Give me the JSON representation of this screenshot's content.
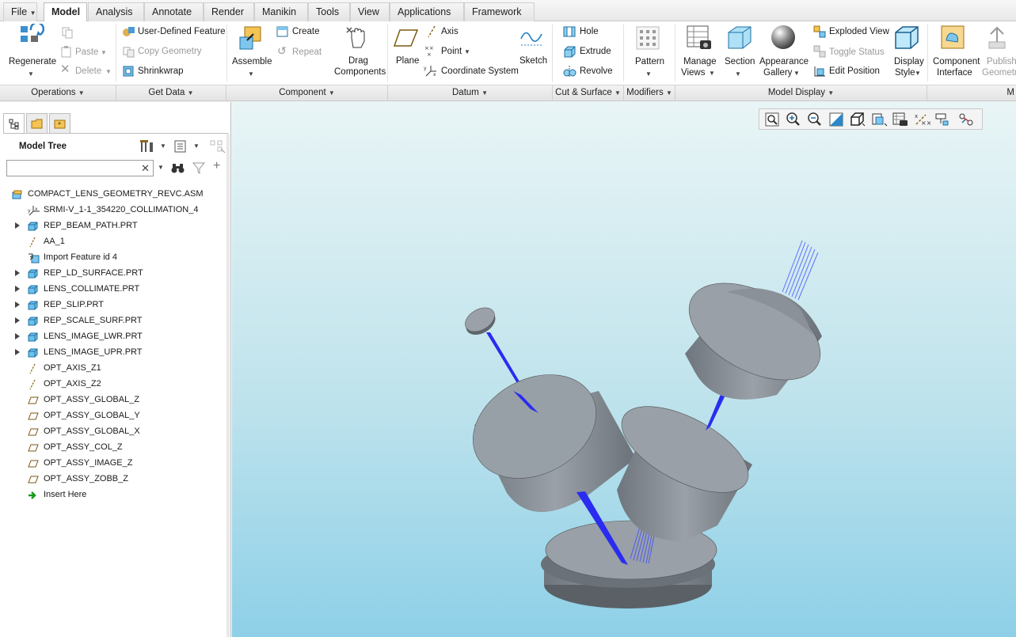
{
  "tabs": [
    "File",
    "Model",
    "Analysis",
    "Annotate",
    "Render",
    "Manikin",
    "Tools",
    "View",
    "Applications",
    "Framework"
  ],
  "active_tab": "Model",
  "ribbon": {
    "regenerate": "Regenerate",
    "paste": "Paste",
    "delete": "Delete",
    "user_defined_feature": "User-Defined Feature",
    "copy_geometry": "Copy Geometry",
    "shrinkwrap": "Shrinkwrap",
    "assemble": "Assemble",
    "create": "Create",
    "repeat": "Repeat",
    "drag_components_1": "Drag",
    "drag_components_2": "Components",
    "plane": "Plane",
    "axis": "Axis",
    "point": "Point",
    "coordinate_system": "Coordinate System",
    "sketch": "Sketch",
    "hole": "Hole",
    "extrude": "Extrude",
    "revolve": "Revolve",
    "pattern": "Pattern",
    "manage_views_1": "Manage",
    "manage_views_2": "Views",
    "section": "Section",
    "appearance_gallery_1": "Appearance",
    "appearance_gallery_2": "Gallery",
    "exploded_view": "Exploded View",
    "toggle_status": "Toggle Status",
    "edit_position": "Edit Position",
    "display_style_1": "Display",
    "display_style_2": "Style",
    "component_interface_1": "Component",
    "component_interface_2": "Interface",
    "publish_geometry_1": "Publish",
    "publish_geometry_2": "Geometry"
  },
  "groups": [
    "Operations",
    "Get Data",
    "Component",
    "Datum",
    "Cut & Surface",
    "Modifiers",
    "Model Display",
    "M"
  ],
  "model_tree": {
    "title": "Model Tree",
    "search_value": "",
    "items": [
      {
        "label": "COMPACT_LENS_GEOMETRY_REVC.ASM",
        "icon": "assembly-icon",
        "expandable": false
      },
      {
        "label": "SRMI-V_1-1_354220_COLLIMATION_4",
        "icon": "coordinate-system-icon",
        "expandable": false
      },
      {
        "label": "REP_BEAM_PATH.PRT",
        "icon": "part-icon",
        "expandable": true
      },
      {
        "label": "AA_1",
        "icon": "datum-axis-icon",
        "expandable": false
      },
      {
        "label": "Import Feature id 4",
        "icon": "import-feature-icon",
        "expandable": false
      },
      {
        "label": "REP_LD_SURFACE.PRT",
        "icon": "part-icon",
        "expandable": true
      },
      {
        "label": "LENS_COLLIMATE.PRT",
        "icon": "part-icon",
        "expandable": true
      },
      {
        "label": "REP_SLIP.PRT",
        "icon": "part-icon",
        "expandable": true
      },
      {
        "label": "REP_SCALE_SURF.PRT",
        "icon": "part-icon",
        "expandable": true
      },
      {
        "label": "LENS_IMAGE_LWR.PRT",
        "icon": "part-icon",
        "expandable": true
      },
      {
        "label": "LENS_IMAGE_UPR.PRT",
        "icon": "part-icon",
        "expandable": true
      },
      {
        "label": "OPT_AXIS_Z1",
        "icon": "datum-axis-icon",
        "expandable": false
      },
      {
        "label": "OPT_AXIS_Z2",
        "icon": "datum-axis-icon",
        "expandable": false
      },
      {
        "label": "OPT_ASSY_GLOBAL_Z",
        "icon": "datum-plane-icon",
        "expandable": false
      },
      {
        "label": "OPT_ASSY_GLOBAL_Y",
        "icon": "datum-plane-icon",
        "expandable": false
      },
      {
        "label": "OPT_ASSY_GLOBAL_X",
        "icon": "datum-plane-icon",
        "expandable": false
      },
      {
        "label": "OPT_ASSY_COL_Z",
        "icon": "datum-plane-icon",
        "expandable": false
      },
      {
        "label": "OPT_ASSY_IMAGE_Z",
        "icon": "datum-plane-icon",
        "expandable": false
      },
      {
        "label": "OPT_ASSY_ZOBB_Z",
        "icon": "datum-plane-icon",
        "expandable": false
      },
      {
        "label": "Insert Here",
        "icon": "insert-here-arrow-icon",
        "expandable": false
      }
    ]
  },
  "colors": {
    "accent": "#2d9bd0",
    "beam": "#2a2cf0",
    "part": "#8e959d"
  }
}
